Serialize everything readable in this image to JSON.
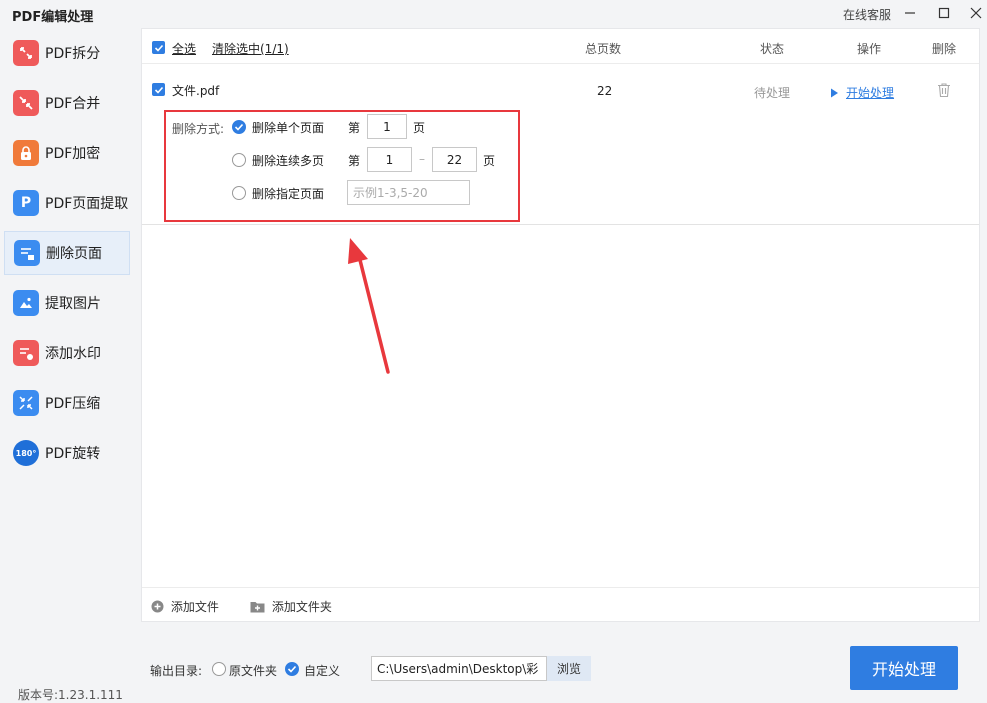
{
  "app_title": "PDF编辑处理",
  "titlebar": {
    "service": "在线客服",
    "minimize": "—",
    "maximize": "☐",
    "close": "✕"
  },
  "sidebar": {
    "items": [
      {
        "label": "PDF拆分",
        "icon": "split-icon",
        "color": "#ef5a5a"
      },
      {
        "label": "PDF合并",
        "icon": "merge-icon",
        "color": "#ef5a5a"
      },
      {
        "label": "PDF加密",
        "icon": "lock-icon",
        "color": "#f07a3a"
      },
      {
        "label": "PDF页面提取",
        "icon": "page-extract-icon",
        "color": "#3b8cf0",
        "glyph": "P"
      },
      {
        "label": "删除页面",
        "icon": "delete-page-icon",
        "color": "#3b8cf0",
        "active": true
      },
      {
        "label": "提取图片",
        "icon": "extract-image-icon",
        "color": "#3b8cf0"
      },
      {
        "label": "添加水印",
        "icon": "watermark-icon",
        "color": "#ef5a5a"
      },
      {
        "label": "PDF压缩",
        "icon": "compress-icon",
        "color": "#3b8cf0"
      },
      {
        "label": "PDF旋转",
        "icon": "rotate-icon",
        "color": "#1f6fd8",
        "glyph": "180°"
      }
    ]
  },
  "version": "版本号:1.23.1.111",
  "table": {
    "select_all": "全选",
    "clear_selected": "清除选中(1/1)",
    "columns": {
      "pages": "总页数",
      "status": "状态",
      "action": "操作",
      "delete": "删除"
    },
    "rows": [
      {
        "filename": "文件.pdf",
        "pages": "22",
        "status": "待处理",
        "action": "开始处理"
      }
    ]
  },
  "delete_options": {
    "mode_label": "删除方式:",
    "single": {
      "label": "删除单个页面",
      "prefix": "第",
      "value": "1",
      "suffix": "页",
      "selected": true
    },
    "range": {
      "label": "删除连续多页",
      "prefix": "第",
      "from": "1",
      "dash": "–",
      "to": "22",
      "suffix": "页",
      "selected": false
    },
    "specific": {
      "label": "删除指定页面",
      "placeholder": "示例1-3,5-20",
      "selected": false
    }
  },
  "footer": {
    "add_file": "添加文件",
    "add_folder": "添加文件夹"
  },
  "output": {
    "label": "输出目录:",
    "original_folder": "原文件夹",
    "custom": "自定义",
    "custom_selected": true,
    "path": "C:\\Users\\admin\\Desktop\\彩",
    "browse": "浏览"
  },
  "start_button": "开始处理",
  "colors": {
    "accent": "#2f7de1",
    "highlight": "#e8383d"
  }
}
